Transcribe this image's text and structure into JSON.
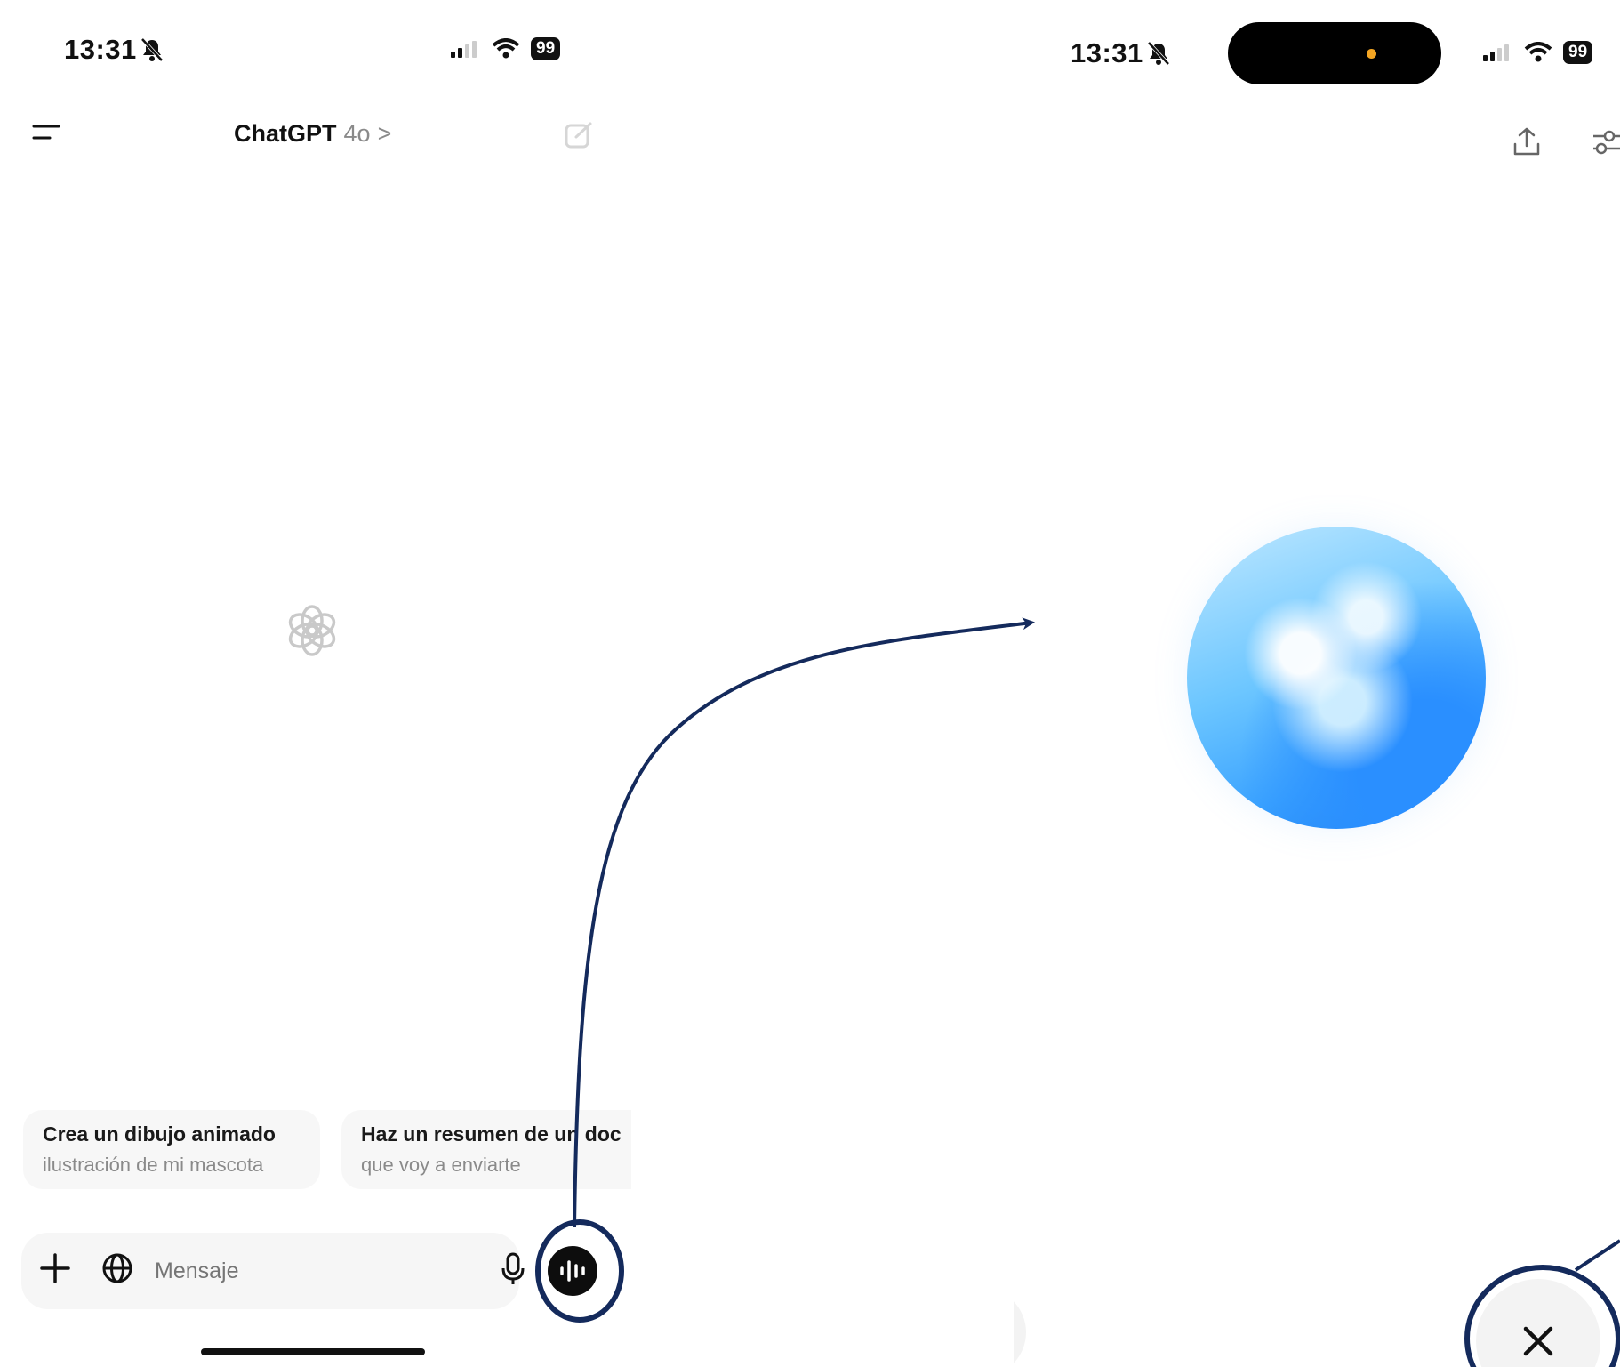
{
  "left_screen": {
    "status_bar": {
      "time": "13:31",
      "battery": "99"
    },
    "header": {
      "app_name": "ChatGPT",
      "model": "4o",
      "chevron": ">"
    },
    "suggestions": [
      {
        "title": "Crea un dibujo animado",
        "subtitle": "ilustración de mi mascota"
      },
      {
        "title": "Haz un resumen de un doc",
        "subtitle": "que voy a enviarte"
      }
    ],
    "composer": {
      "placeholder": "Mensaje"
    }
  },
  "right_screen": {
    "status_bar": {
      "time": "13:31",
      "battery": "99"
    }
  },
  "colors": {
    "annotation": "#142a5c",
    "orb_blue": "#3aa2ff",
    "indicator_orange": "#f5a623"
  },
  "icons": {
    "menu": "hamburger-icon",
    "new_chat": "edit-icon",
    "plus": "plus-icon",
    "globe": "globe-icon",
    "mic": "microphone-icon",
    "voice_mode": "voice-waveform-icon",
    "share": "share-icon",
    "settings": "sliders-icon",
    "close": "close-icon",
    "logo": "openai-logo-icon"
  }
}
